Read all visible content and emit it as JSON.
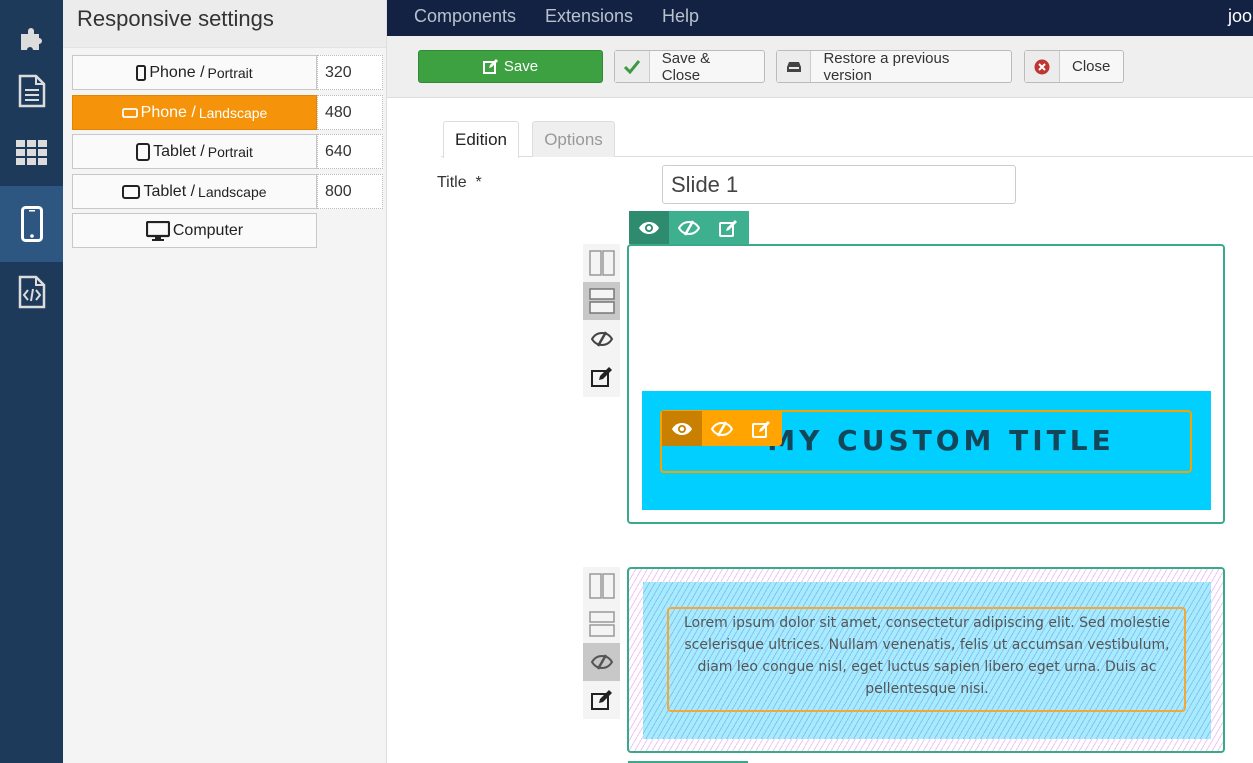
{
  "sidebar_icons": [
    {
      "name": "puzzle-icon",
      "active": false
    },
    {
      "name": "document-icon",
      "active": false
    },
    {
      "name": "grid-icon",
      "active": false
    },
    {
      "name": "phone-icon",
      "active": true
    },
    {
      "name": "code-file-icon",
      "active": false
    }
  ],
  "responsive": {
    "title": "Responsive settings",
    "devices": [
      {
        "main": "Phone /",
        "sub": "Portrait",
        "width": "320",
        "icon": "phone-portrait-icon",
        "active": false
      },
      {
        "main": "Phone /",
        "sub": "Landscape",
        "width": "480",
        "icon": "phone-landscape-icon",
        "active": true
      },
      {
        "main": "Tablet /",
        "sub": "Portrait",
        "width": "640",
        "icon": "tablet-portrait-icon",
        "active": false
      },
      {
        "main": "Tablet /",
        "sub": "Landscape",
        "width": "800",
        "icon": "tablet-landscape-icon",
        "active": false
      },
      {
        "main": "Computer",
        "sub": "",
        "width": null,
        "icon": "monitor-icon",
        "active": false
      }
    ]
  },
  "topnav": {
    "items": [
      "Components",
      "Extensions",
      "Help"
    ],
    "user": "joo"
  },
  "toolbar": {
    "save": "Save",
    "save_close": "Save & Close",
    "restore": "Restore a previous version",
    "close": "Close"
  },
  "tabs": {
    "edition": "Edition",
    "options": "Options"
  },
  "form": {
    "title_label": "Title",
    "required_mark": "*",
    "title_value": "Slide 1"
  },
  "slides": {
    "custom_title": "MY CUSTOM TITLE",
    "lorem": "Lorem ipsum dolor sit amet, consectetur adipiscing elit. Sed molestie scelerisque ultrices. Nullam venenatis, felis ut accumsan vestibulum, diam leo congue nisl, eget luctus sapien libero eget urna. Duis ac pellentesque nisi."
  },
  "colors": {
    "accent_orange": "#f5940a",
    "save_green": "#3da142",
    "slide_green": "#3aa98a",
    "cyan": "#00cfff"
  }
}
